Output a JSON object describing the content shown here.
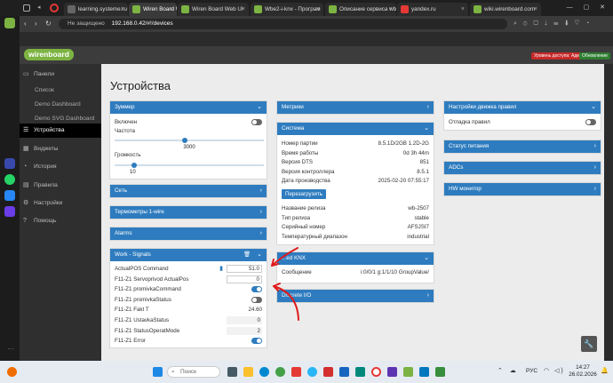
{
  "browser": {
    "tabs": [
      {
        "label": "learning.systeme.ru",
        "color": "#666666"
      },
      {
        "label": "Wiren Board Web UI",
        "color": "#7cb342"
      },
      {
        "label": "Wiren Board Web UI",
        "color": "#7cb342"
      },
      {
        "label": "Wbe2-i-knx - Програм",
        "color": "#7cb342"
      },
      {
        "label": "Описание сервиса wb-",
        "color": "#7cb342"
      },
      {
        "label": "yandex.ru",
        "color": "#e53935"
      },
      {
        "label": "wiki.wirenboard.com",
        "color": "#7cb342"
      }
    ],
    "security_label": "Не защищено",
    "url": "192.168.0.42/#!/devices"
  },
  "app": {
    "logo": "wirenboard",
    "access_badge": "Уровень доступа: Администратор",
    "update_badge": "Обновление",
    "page_title": "Устройства",
    "sidebar": [
      {
        "label": "Панели",
        "icon": "panels-icon",
        "sub": false,
        "active": false
      },
      {
        "label": "Список",
        "icon": "",
        "sub": true,
        "active": false
      },
      {
        "label": "Demo Dashboard",
        "icon": "",
        "sub": true,
        "active": false
      },
      {
        "label": "Demo SVG Dashboard",
        "icon": "",
        "sub": true,
        "active": false
      },
      {
        "label": "Устройства",
        "icon": "devices-icon",
        "sub": false,
        "active": true
      },
      {
        "label": "Виджеты",
        "icon": "widgets-icon",
        "sub": false,
        "active": false
      },
      {
        "label": "История",
        "icon": "history-icon",
        "sub": false,
        "active": false
      },
      {
        "label": "Правила",
        "icon": "rules-icon",
        "sub": false,
        "active": false
      },
      {
        "label": "Настройки",
        "icon": "settings-icon",
        "sub": false,
        "active": false
      },
      {
        "label": "Помощь",
        "icon": "help-icon",
        "sub": false,
        "active": false
      }
    ]
  },
  "col1": {
    "zoomer": {
      "title": "Зуммер",
      "enabled_label": "Включен",
      "freq_label": "Частота",
      "freq_value": "3000",
      "freq_fraction": 0.47,
      "volume_label": "Громкость",
      "volume_value": "10",
      "volume_fraction": 0.13
    },
    "collapsed": [
      "Сеть",
      "Термометры 1-wire",
      "Alarms"
    ],
    "signals": {
      "title": "Work - Signals",
      "rows": [
        {
          "label": "ActualPOS Command",
          "value": "51.0",
          "kind": "input"
        },
        {
          "label": "F11-Z1 Servoprivod ActualPos",
          "value": "0",
          "kind": "input"
        },
        {
          "label": "F11-Z1 promivkaCommand",
          "value": "",
          "kind": "toggle-on"
        },
        {
          "label": "F11-Z1 promivkaStatus",
          "value": "",
          "kind": "toggle-off"
        },
        {
          "label": "F11-Z1 Fakt T",
          "value": "24.60",
          "kind": "text"
        },
        {
          "label": "F11-Z1 UstavkaStatus",
          "value": "0",
          "kind": "ghost"
        },
        {
          "label": "F11-Z1 StatusOperatMode",
          "value": "2",
          "kind": "ghost"
        },
        {
          "label": "F11-Z1 Error",
          "value": "",
          "kind": "toggle-on"
        }
      ]
    }
  },
  "col2": {
    "metrics_title": "Метрики",
    "system": {
      "title": "Система",
      "rows1": [
        {
          "label": "Номер партии",
          "value": "8.5.1D/2GB 1.2D-2G"
        },
        {
          "label": "Время работы",
          "value": "0d 3h 44m"
        },
        {
          "label": "Версия DTS",
          "value": "851"
        },
        {
          "label": "Версия контроллера",
          "value": "8.5.1"
        },
        {
          "label": "Дата производства",
          "value": "2025-02-20 07:55:17"
        }
      ],
      "reboot_label": "Перезагрузить",
      "rows2": [
        {
          "label": "Название релиза",
          "value": "wb-2507"
        },
        {
          "label": "Тип релиза",
          "value": "stable"
        },
        {
          "label": "Серийный номер",
          "value": "AFSJSI7"
        },
        {
          "label": "Температурный диапазон",
          "value": "industrial"
        }
      ]
    },
    "knx": {
      "title": "...ed KNX",
      "msg_label": "Сообщение",
      "msg_value": "i:0/0/1 g:1/1/10 GroupValue/"
    },
    "discrete_title": "Discrete I/O"
  },
  "col3": {
    "rules": {
      "title": "Настройки движка правил",
      "debug_label": "Отладка правил"
    },
    "collapsed": [
      "Статус питания",
      "ADCs",
      "HW монитор"
    ]
  },
  "taskbar": {
    "search_placeholder": "Поиск",
    "lang": "РУС",
    "time": "14:27",
    "date": "26.02.2026"
  },
  "colors": {
    "accent": "#2e7cbf",
    "brand": "#7cb342",
    "annotation": "#e01b1b"
  }
}
